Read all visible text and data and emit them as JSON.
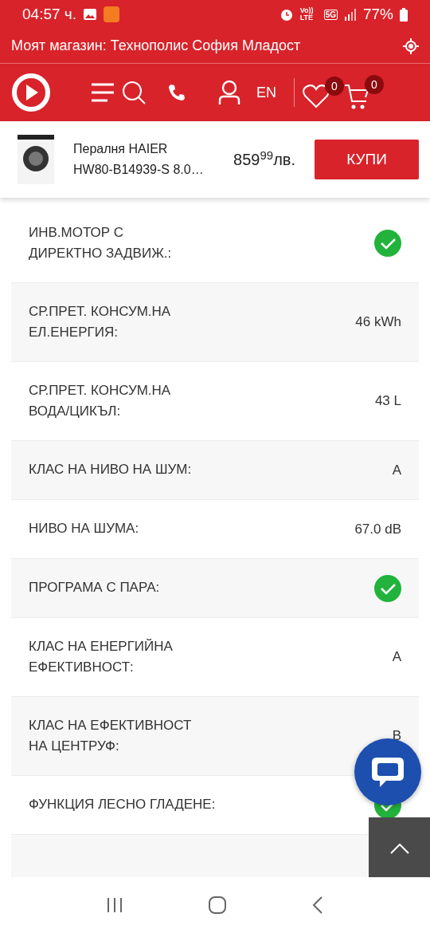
{
  "status_bar": {
    "time": "04:57 ч.",
    "network": "Vo)) LTE",
    "network_type": "5G",
    "battery": "77%"
  },
  "store_bar": {
    "text": "Моят магазин: Технополис София Младост"
  },
  "nav": {
    "language": "EN",
    "wishlist_count": "0",
    "cart_count": "0"
  },
  "product_bar": {
    "title": "Пералня HAIER HW80-B14939-S 8.0…",
    "price": "859",
    "price_cents": "99",
    "currency": "лв.",
    "buy_button": "КУПИ"
  },
  "specs": [
    {
      "label": "ИНВ.МОТОР С ДИРЕКТНО ЗАДВИЖ.:",
      "kind": "check"
    },
    {
      "label": "СР.ПРЕТ. КОНСУМ.НА ЕЛ.ЕНЕРГИЯ:",
      "kind": "text",
      "value": "46 kWh"
    },
    {
      "label": "СР.ПРЕТ. КОНСУМ.НА ВОДА/ЦИКЪЛ:",
      "kind": "text",
      "value": "43 L"
    },
    {
      "label": "КЛАС НА НИВО НА ШУМ:",
      "kind": "text",
      "value": "A"
    },
    {
      "label": "НИВО НА ШУМА:",
      "kind": "text",
      "value": "67.0 dB"
    },
    {
      "label": "ПРОГРАМА С ПАРА:",
      "kind": "check"
    },
    {
      "label": "КЛАС НА ЕНЕРГИЙНА ЕФЕКТИВНОСТ:",
      "kind": "text",
      "value": "A"
    },
    {
      "label": "КЛАС НА ЕФЕКТИВНОСТ НА ЦЕНТРУФ:",
      "kind": "text",
      "value": "B"
    },
    {
      "label": "ФУНКЦИЯ ЛЕСНО ГЛАДЕНЕ:",
      "kind": "check"
    }
  ]
}
